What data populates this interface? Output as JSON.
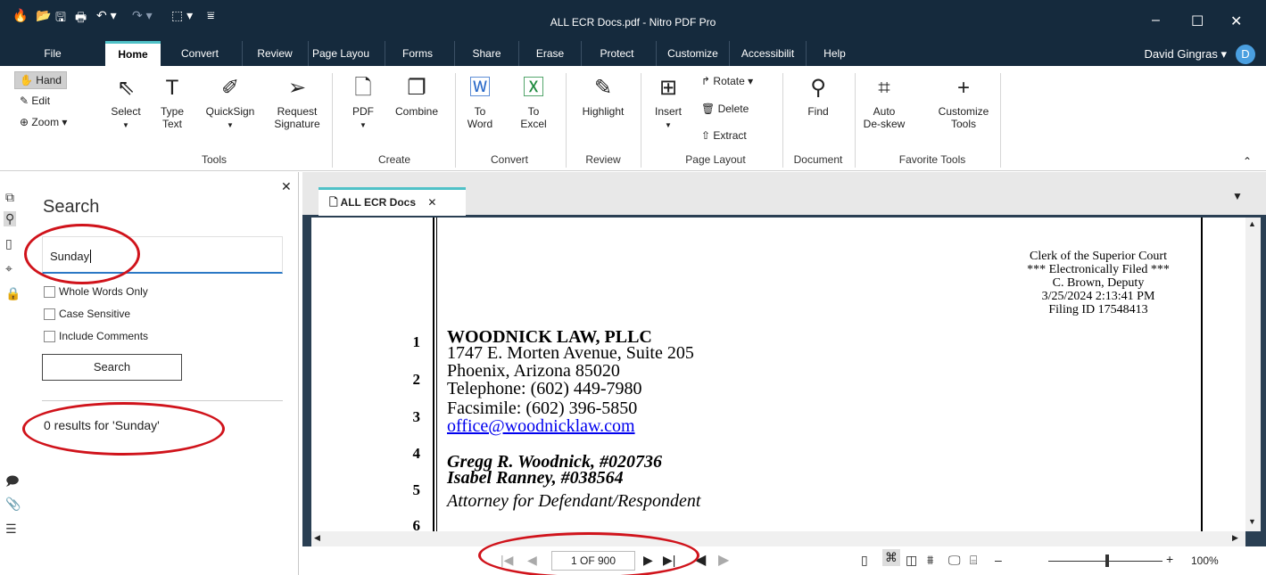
{
  "window": {
    "title": "ALL ECR Docs.pdf - Nitro PDF Pro"
  },
  "menu": {
    "items": [
      "File",
      "Home",
      "Convert",
      "Review",
      "Page Layou",
      "Forms",
      "Share",
      "Erase",
      "Protect",
      "Customize",
      "Accessibilit",
      "Help"
    ],
    "user": "David Gingras ▾",
    "avatar": "D"
  },
  "ribbon": {
    "hand": "Hand",
    "edit": "Edit",
    "zoom": "Zoom ▾",
    "select": "Select",
    "type_text": "Type\nText",
    "quicksign": "QuickSign",
    "request_sig": "Request\nSignature",
    "pdf": "PDF",
    "combine": "Combine",
    "to_word": "To\nWord",
    "to_excel": "To\nExcel",
    "highlight": "Highlight",
    "insert": "Insert",
    "rotate": "Rotate ▾",
    "delete": "Delete",
    "extract": "Extract",
    "find": "Find",
    "auto_deskew": "Auto\nDe-skew",
    "customize_tools": "Customize\nTools",
    "groups": {
      "tools": "Tools",
      "create": "Create",
      "convert": "Convert",
      "review": "Review",
      "page_layout": "Page Layout",
      "document": "Document",
      "favorite": "Favorite Tools"
    }
  },
  "search": {
    "title": "Search",
    "query": "Sunday",
    "whole_words": "Whole Words Only",
    "case_sensitive": "Case Sensitive",
    "include_comments": "Include Comments",
    "button": "Search",
    "results": "0 results for 'Sunday'"
  },
  "tab": {
    "label": "ALL ECR Docs",
    "close": "✕"
  },
  "document": {
    "stamp": [
      "Clerk of the Superior Court",
      "*** Electronically Filed ***",
      "C. Brown, Deputy",
      "3/25/2024 2:13:41 PM",
      "Filing ID 17548413"
    ],
    "line_numbers": [
      "1",
      "2",
      "3",
      "4",
      "5",
      "6"
    ],
    "firm": "WOODNICK LAW, PLLC",
    "address1": "1747 E. Morten Avenue, Suite 205",
    "address2": "Phoenix, Arizona 85020",
    "telephone": "Telephone: (602) 449-7980",
    "fax": "Facsimile: (602) 396-5850",
    "email": "office@woodnicklaw.com",
    "attorney1": "Gregg R. Woodnick, #020736",
    "attorney2": "Isabel Ranney, #038564",
    "role": "Attorney for Defendant/Respondent"
  },
  "status": {
    "page": "1 OF 900",
    "zoom": "100%",
    "zoom_level": 1.0
  },
  "colors": {
    "titlebar": "#152a3d",
    "accent": "#4fc1c7",
    "annotation": "#d0131b",
    "link": "#0000ee"
  }
}
